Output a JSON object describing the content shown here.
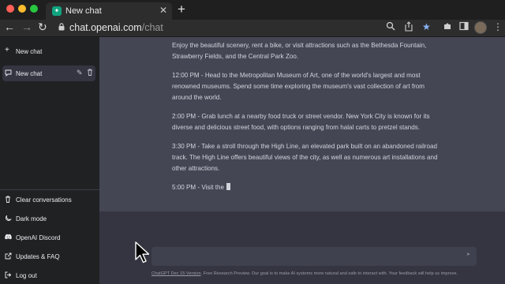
{
  "browser": {
    "tab_title": "New chat",
    "url_host": "chat.openai.com",
    "url_path": "/chat"
  },
  "sidebar": {
    "new_chat": "New chat",
    "chats": [
      {
        "label": "New chat"
      }
    ],
    "bottom_links": [
      {
        "label": "Clear conversations",
        "icon": "trash-icon"
      },
      {
        "label": "Dark mode",
        "icon": "moon-icon"
      },
      {
        "label": "OpenAI Discord",
        "icon": "discord-icon"
      },
      {
        "label": "Updates & FAQ",
        "icon": "external-link-icon"
      },
      {
        "label": "Log out",
        "icon": "logout-icon"
      }
    ]
  },
  "conversation": {
    "paragraphs": [
      "Enjoy the beautiful scenery, rent a bike, or visit attractions such as the Bethesda Fountain, Strawberry Fields, and the Central Park Zoo.",
      "12:00 PM - Head to the Metropolitan Museum of Art, one of the world's largest and most renowned museums. Spend some time exploring the museum's vast collection of art from around the world.",
      "2:00 PM - Grab lunch at a nearby food truck or street vendor. New York City is known for its diverse and delicious street food, with options ranging from halal carts to pretzel stands.",
      "3:30 PM - Take a stroll through the High Line, an elevated park built on an abandoned railroad track. The High Line offers beautiful views of the city, as well as numerous art installations and other attractions.",
      "5:00 PM - Visit the"
    ]
  },
  "footer": {
    "version_link": "ChatGPT Dec 15 Version",
    "text": ". Free Research Preview. Our goal is to make AI systems more natural and safe to interact with. Your feedback will help us improve."
  },
  "colors": {
    "sidebar_bg": "#202123",
    "main_bg": "#343541",
    "answer_bg": "#444654",
    "input_bg": "#40414f",
    "star_accent": "#8ab4f8"
  }
}
